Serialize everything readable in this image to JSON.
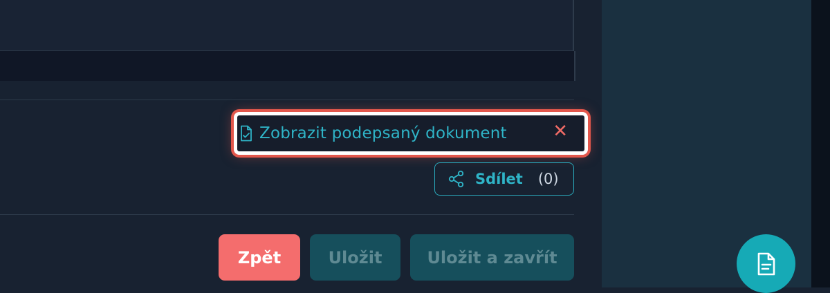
{
  "signed_document": {
    "label": "Zobrazit podepsaný dokument",
    "close_symbol": "✕",
    "icon": "file-signature-icon"
  },
  "share": {
    "label": "Sdílet",
    "count": "(0)",
    "icon": "share-icon"
  },
  "actions": {
    "back_label": "Zpět",
    "save_label": "Uložit",
    "save_close_label": "Uložit a zavřít"
  },
  "fab": {
    "icon": "document-icon"
  },
  "colors": {
    "accent": "#2fb4c7",
    "danger": "#f46d6d",
    "disabled_button": "#164f5c",
    "highlight_ring": "#e2574c"
  }
}
